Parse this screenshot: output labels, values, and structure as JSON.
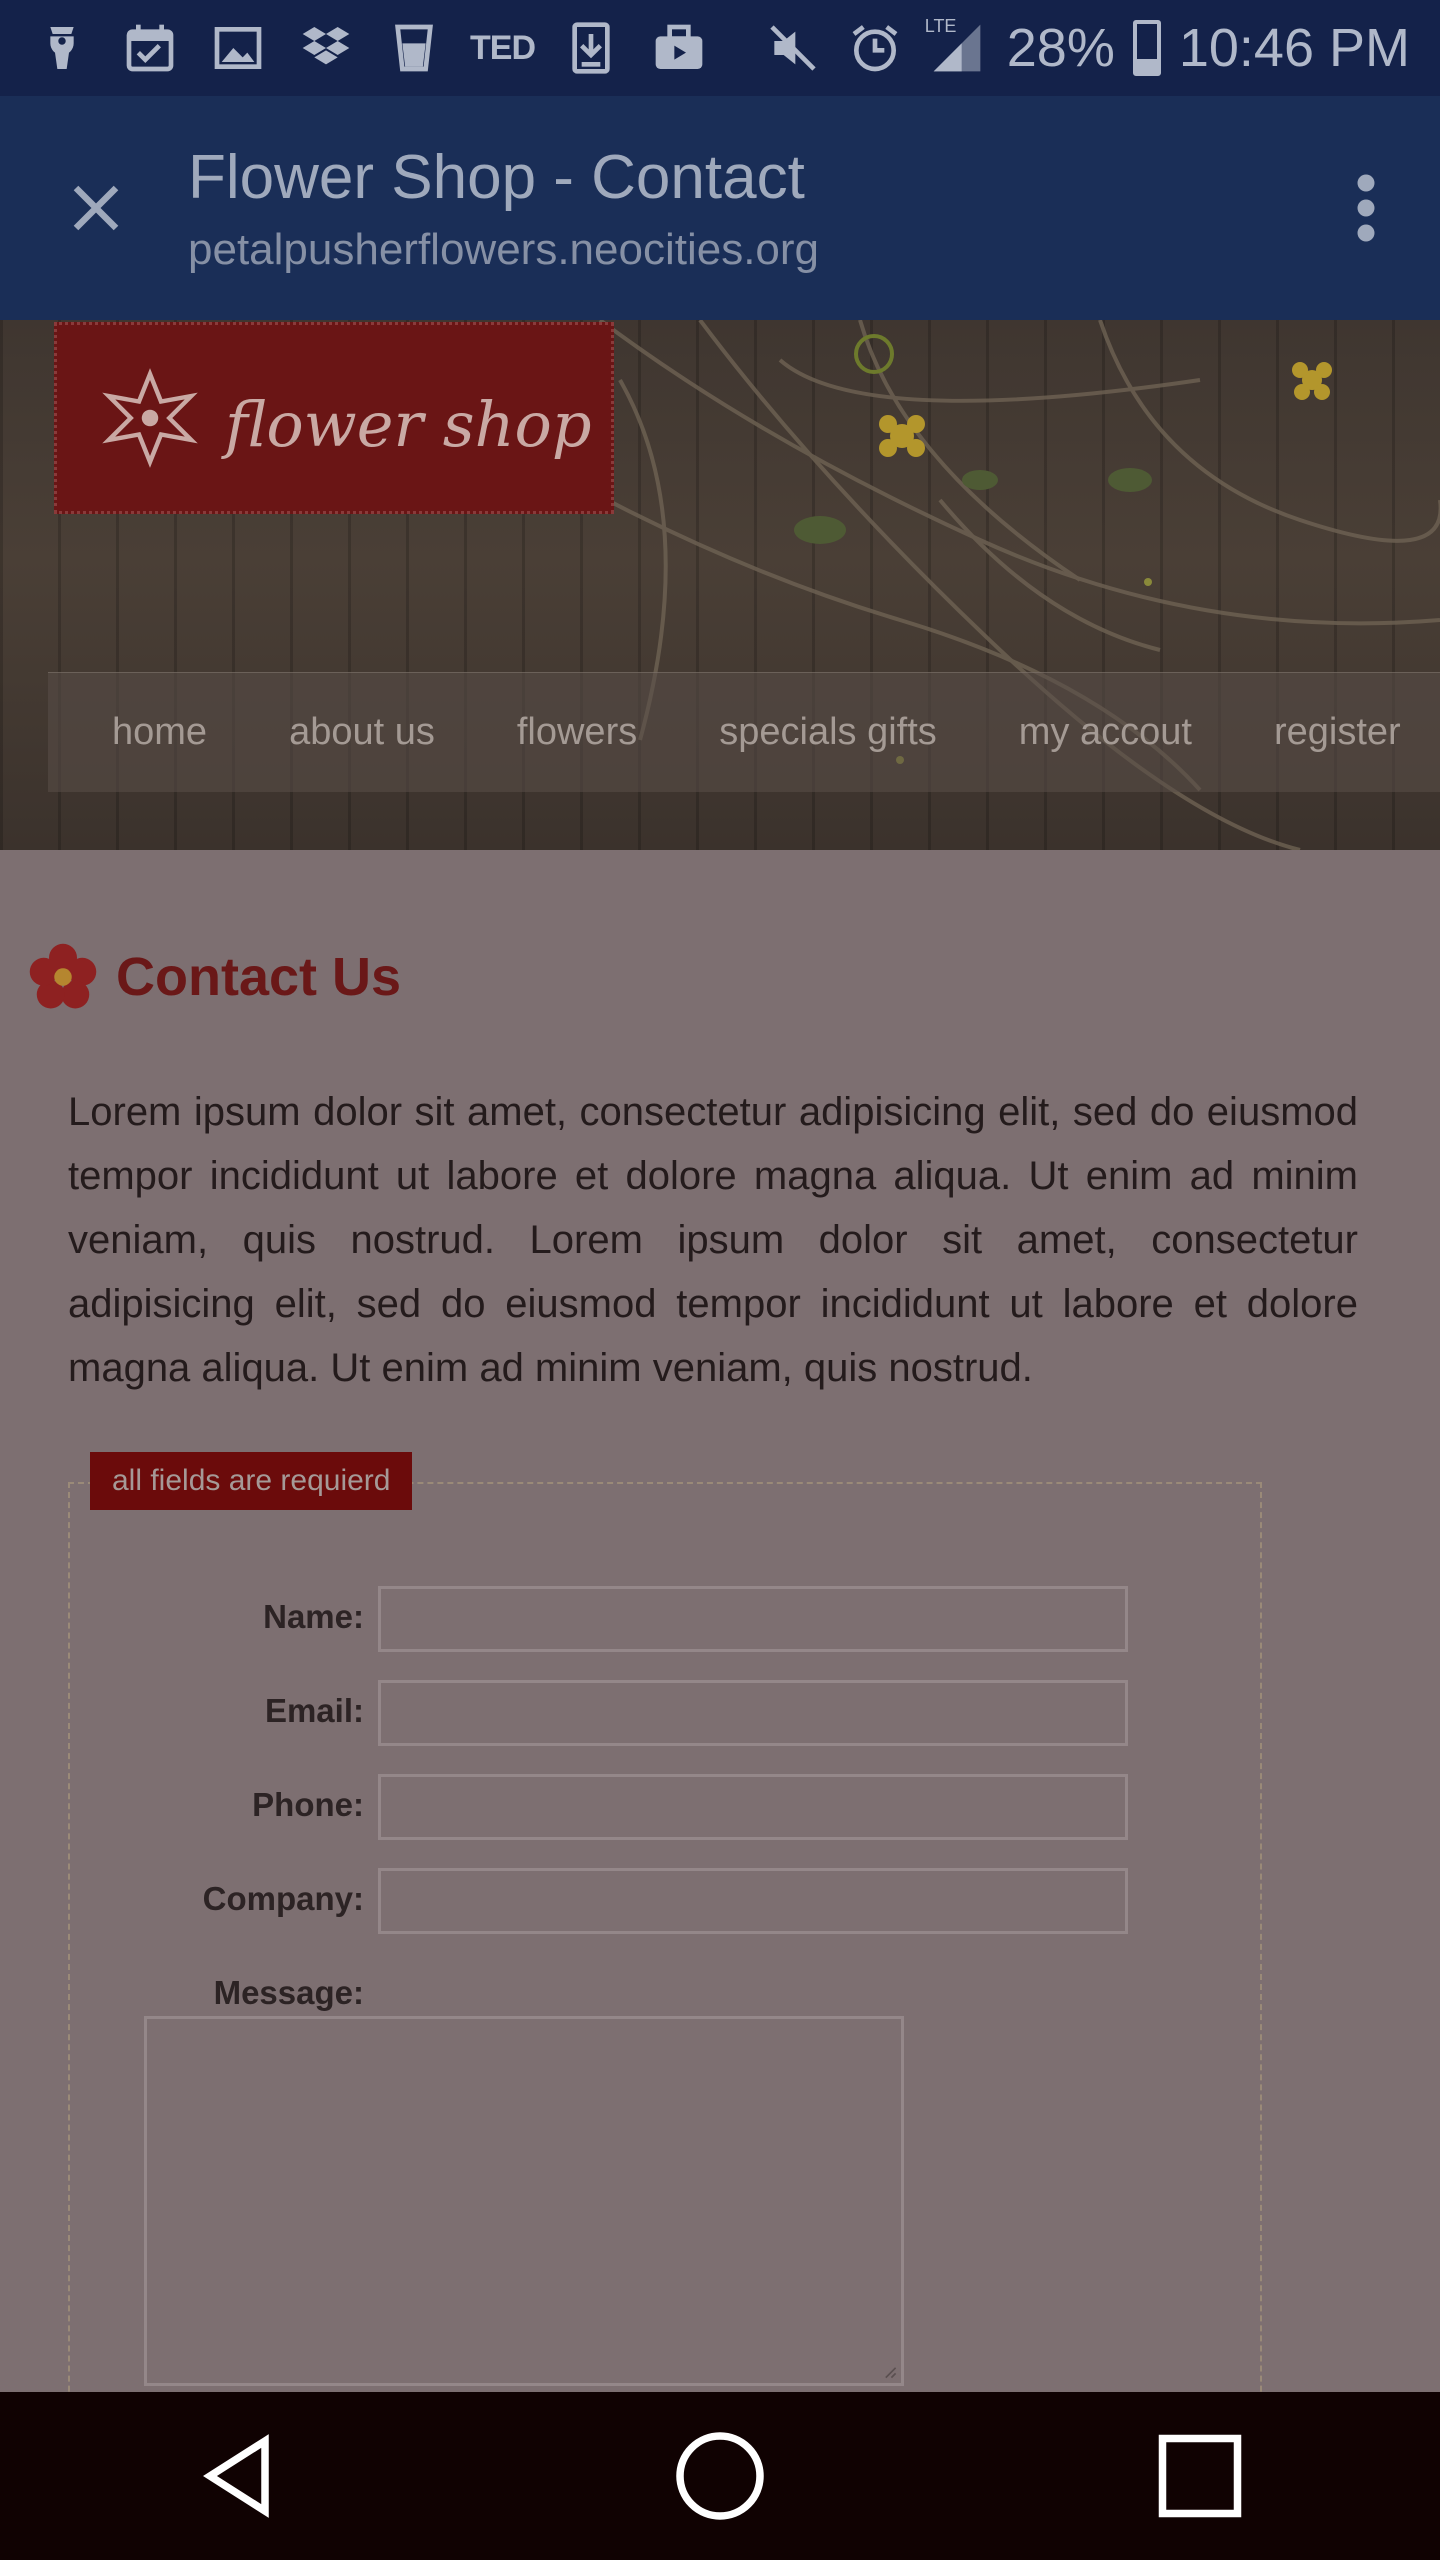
{
  "status_bar": {
    "notification_icons": [
      "cup-icon",
      "calendar-check-icon",
      "image-icon",
      "dropbox-icon",
      "glass-icon",
      "ted-icon",
      "download-icon",
      "briefcase-icon"
    ],
    "ted_label": "TED",
    "network_label": "LTE",
    "battery_percent": "28%",
    "battery_level": 0.28,
    "clock": "10:46 PM"
  },
  "toolbar": {
    "title": "Flower Shop - Contact",
    "url": "petalpusherflowers.neocities.org"
  },
  "header": {
    "logo_text": "flower shop",
    "nav_items": [
      "home",
      "about us",
      "flowers",
      "specials gifts",
      "my accout",
      "register"
    ]
  },
  "main": {
    "heading": "Contact Us",
    "intro": "Lorem ipsum dolor sit amet, consectetur adipisicing elit, sed do eiusmod tempor incididunt ut labore et dolore magna aliqua. Ut enim ad minim veniam, quis nostrud. Lorem ipsum dolor sit amet, consectetur adipisicing elit, sed do eiusmod tempor incididunt ut labore et dolore magna aliqua. Ut enim ad minim veniam, quis nostrud.",
    "form": {
      "required_note": "all fields are requierd",
      "name_label": "Name:",
      "email_label": "Email:",
      "phone_label": "Phone:",
      "company_label": "Company:",
      "message_label": "Message:",
      "name_value": "",
      "email_value": "",
      "phone_value": "",
      "company_value": "",
      "message_value": ""
    }
  },
  "colors": {
    "status_bar": "#14224a",
    "toolbar": "#1a2e57",
    "page_bg": "#7d6f71",
    "heading": "#6a1818",
    "badge": "#6b0b0b",
    "nav_bar": "#100202"
  }
}
